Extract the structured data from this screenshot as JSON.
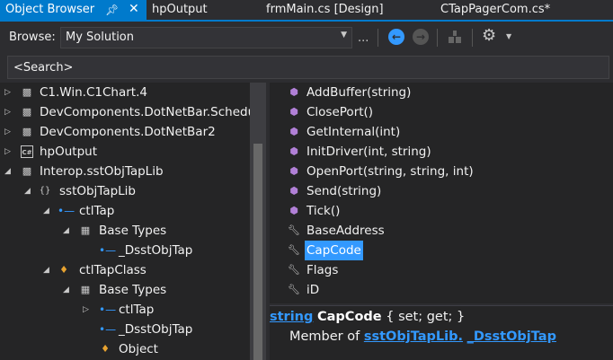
{
  "tabs": [
    {
      "label": "Object Browser",
      "active": true
    },
    {
      "label": "hpOutput"
    },
    {
      "label": "frmMain.cs [Design]"
    },
    {
      "label": "CTapPagerCom.cs*"
    }
  ],
  "toolbar": {
    "browse_label": "Browse:",
    "browse_value": "My Solution",
    "ellipsis": "..."
  },
  "search": {
    "value": "<Search>"
  },
  "tree": [
    {
      "label": "C1.Win.C1Chart.4",
      "icon": "assembly-icon"
    },
    {
      "label": "DevComponents.DotNetBar.Schedule",
      "icon": "assembly-icon"
    },
    {
      "label": "DevComponents.DotNetBar2",
      "icon": "assembly-icon"
    },
    {
      "label": "hpOutput",
      "icon": "csharp-project-icon",
      "badge": "C#"
    },
    {
      "label": "Interop.sstObjTapLib",
      "icon": "assembly-icon"
    },
    {
      "label": "sstObjTapLib",
      "icon": "namespace-icon"
    },
    {
      "label": "ctlTap",
      "icon": "interface-icon"
    },
    {
      "label": "Base Types",
      "icon": "folder-icon"
    },
    {
      "label": "_DsstObjTap",
      "icon": "interface-icon"
    },
    {
      "label": "ctlTapClass",
      "icon": "class-icon"
    },
    {
      "label": "Base Types",
      "icon": "folder-icon"
    },
    {
      "label": "ctlTap",
      "icon": "interface-icon"
    },
    {
      "label": "_DsstObjTap",
      "icon": "interface-icon"
    },
    {
      "label": "Object",
      "icon": "class-icon"
    }
  ],
  "members": [
    {
      "label": "AddBuffer(string)",
      "icon": "method-icon"
    },
    {
      "label": "ClosePort()",
      "icon": "method-icon"
    },
    {
      "label": "GetInternal(int)",
      "icon": "method-icon"
    },
    {
      "label": "InitDriver(int, string)",
      "icon": "method-icon"
    },
    {
      "label": "OpenPort(string, string, int)",
      "icon": "method-icon"
    },
    {
      "label": "Send(string)",
      "icon": "method-icon"
    },
    {
      "label": "Tick()",
      "icon": "method-icon"
    },
    {
      "label": "BaseAddress",
      "icon": "property-icon"
    },
    {
      "label": "CapCode",
      "icon": "property-icon",
      "selected": true
    },
    {
      "label": "Flags",
      "icon": "property-icon"
    },
    {
      "label": "iD",
      "icon": "property-icon"
    }
  ],
  "description": {
    "type_link": "string",
    "member_name": "CapCode",
    "accessors": "{ set; get; }",
    "member_of_label": "Member of",
    "namespace_link": "sstObjTapLib",
    "separator": ".",
    "interface_link": "_DsstObjTap"
  },
  "colors": {
    "accent": "#007acc",
    "selection": "#3399ff",
    "method_icon": "#b180d7",
    "background": "#252526"
  }
}
